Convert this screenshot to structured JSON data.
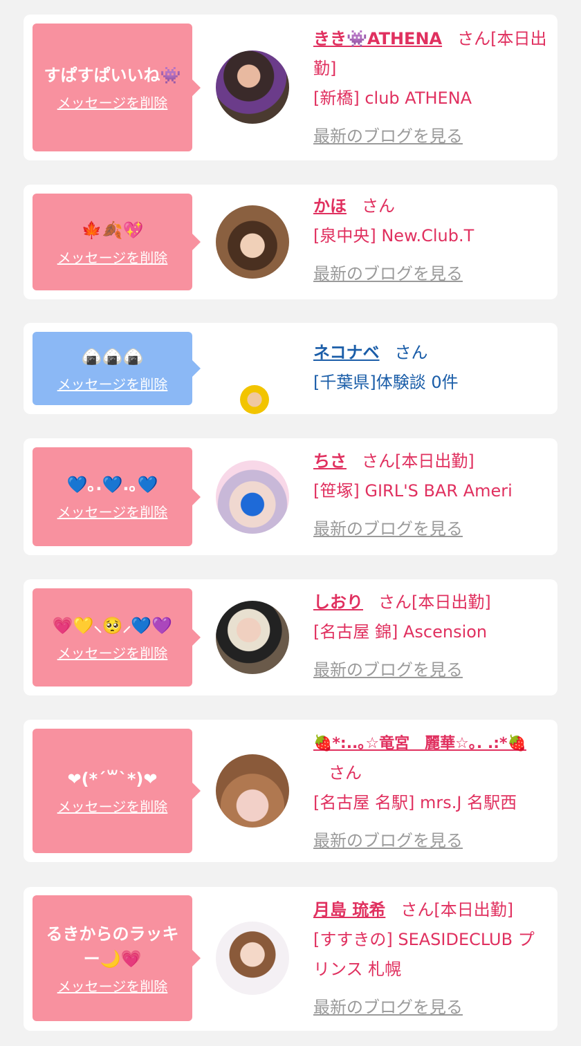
{
  "messages": [
    {
      "bubble": "すぱすぱいいね👾",
      "delete": "メッセージを削除",
      "name": "きき👾ATHENA",
      "san": "さん",
      "status": "[本日出勤]",
      "shop": "[新橋] club ATHENA",
      "blog": "最新のブログを見る"
    },
    {
      "bubble": "🍁🍂💖",
      "delete": "メッセージを削除",
      "name": "かほ",
      "san": "さん",
      "status": "",
      "shop": "[泉中央] New.Club.T",
      "blog": "最新のブログを見る"
    },
    {
      "bubble": "🍙🍙🍙",
      "delete": "メッセージを削除",
      "name": "ネコナベ",
      "san": "さん",
      "status": "",
      "shop": "[千葉県]体験談 0件",
      "blog": ""
    },
    {
      "bubble": "💙｡.💙.｡💙",
      "delete": "メッセージを削除",
      "name": "ちさ",
      "san": "さん",
      "status": "[本日出勤]",
      "shop": "[笹塚] GIRL'S BAR Ameri",
      "blog": "最新のブログを見る"
    },
    {
      "bubble": "💗💛⸜🥺⸝💙💜",
      "delete": "メッセージを削除",
      "name": "しおり",
      "san": "さん",
      "status": "[本日出勤]",
      "shop": "[名古屋 錦] Ascension",
      "blog": "最新のブログを見る"
    },
    {
      "bubble": "❤(*´꒳`*)❤",
      "delete": "メッセージを削除",
      "name": "🍓*:..｡☆竜宮　麗華☆｡. .:*🍓",
      "san": "さん",
      "status": "",
      "shop": "[名古屋 名駅] mrs.J 名駅西",
      "blog": "最新のブログを見る"
    },
    {
      "bubble": "るきからのラッキー🌙💗",
      "delete": "メッセージを削除",
      "name": "月島 琉希",
      "san": "さん",
      "status": "[本日出勤]",
      "shop": "[すすきの] SEASIDECLUB プリンス 札幌",
      "blog": "最新のブログを見る"
    }
  ],
  "colors": {
    "pink_bubble": "#f8919f",
    "blue_bubble": "#8bb8f5",
    "name_pink": "#e0305f",
    "name_blue": "#1a5da8",
    "blog_gray": "#9a9a9a"
  }
}
